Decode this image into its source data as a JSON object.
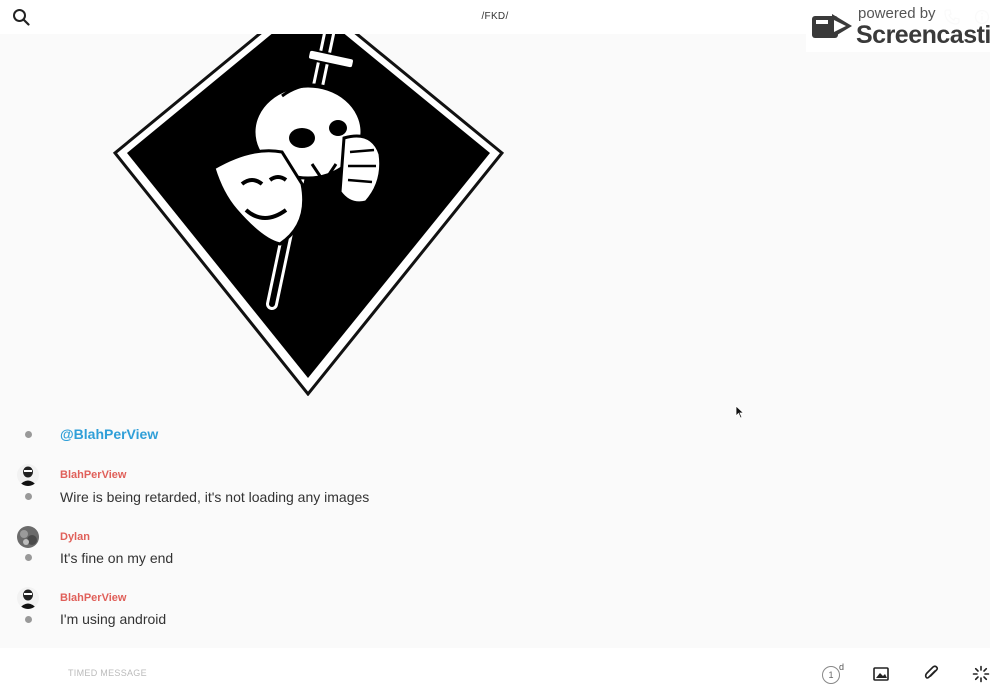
{
  "header": {
    "title": "/FKD/"
  },
  "watermark": {
    "small": "powered by",
    "big": "Screencastify"
  },
  "mention": "@BlahPerView",
  "messages": [
    {
      "sender": "BlahPerView",
      "text": "Wire is being retarded, it's not loading any images",
      "sender_color": "#e0605a"
    },
    {
      "sender": "Dylan",
      "text": "It's fine on my end",
      "sender_color": "#e0605a"
    },
    {
      "sender": "BlahPerView",
      "text": "I'm using android",
      "sender_color": "#e0605a"
    }
  ],
  "composer": {
    "placeholder": "TIMED MESSAGE",
    "timer_value": "1",
    "timer_unit": "d"
  },
  "colors": {
    "mention": "#2f9fd8",
    "sender": "#e0605a",
    "background": "#fafafa"
  },
  "icons": [
    "search-icon",
    "call-icon",
    "info-icon",
    "image-icon",
    "paperclip-icon",
    "more-icon",
    "timer-icon"
  ]
}
